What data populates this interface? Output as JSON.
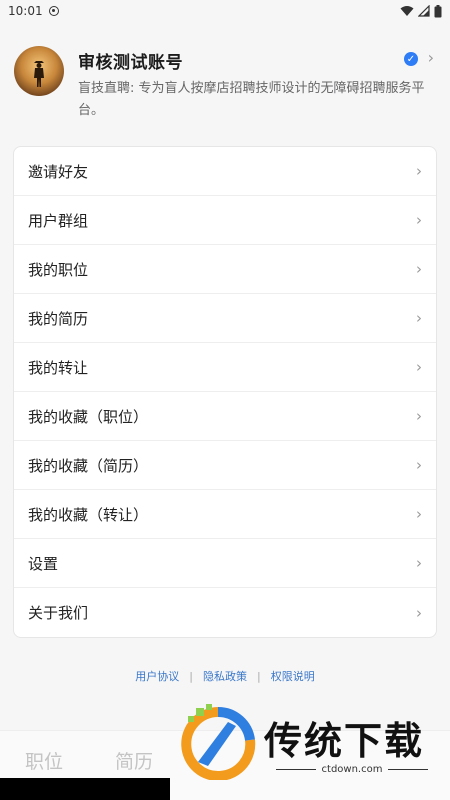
{
  "status_bar": {
    "time": "10:01"
  },
  "profile": {
    "name": "审核测试账号",
    "description": "盲技直聘: 专为盲人按摩店招聘技师设计的无障碍招聘服务平台。"
  },
  "menu": {
    "items": [
      {
        "label": "邀请好友"
      },
      {
        "label": "用户群组"
      },
      {
        "label": "我的职位"
      },
      {
        "label": "我的简历"
      },
      {
        "label": "我的转让"
      },
      {
        "label": "我的收藏（职位）"
      },
      {
        "label": "我的收藏（简历）"
      },
      {
        "label": "我的收藏（转让）"
      },
      {
        "label": "设置"
      },
      {
        "label": "关于我们"
      }
    ]
  },
  "footer": {
    "links": [
      "用户协议",
      "隐私政策",
      "权限说明"
    ],
    "separator": "|"
  },
  "tabbar": {
    "tabs": [
      "职位",
      "简历"
    ]
  },
  "watermark": {
    "text": "传统下载",
    "url": "ctdown.com"
  },
  "colors": {
    "accent": "#2e7cf6",
    "link": "#3a77c9"
  }
}
